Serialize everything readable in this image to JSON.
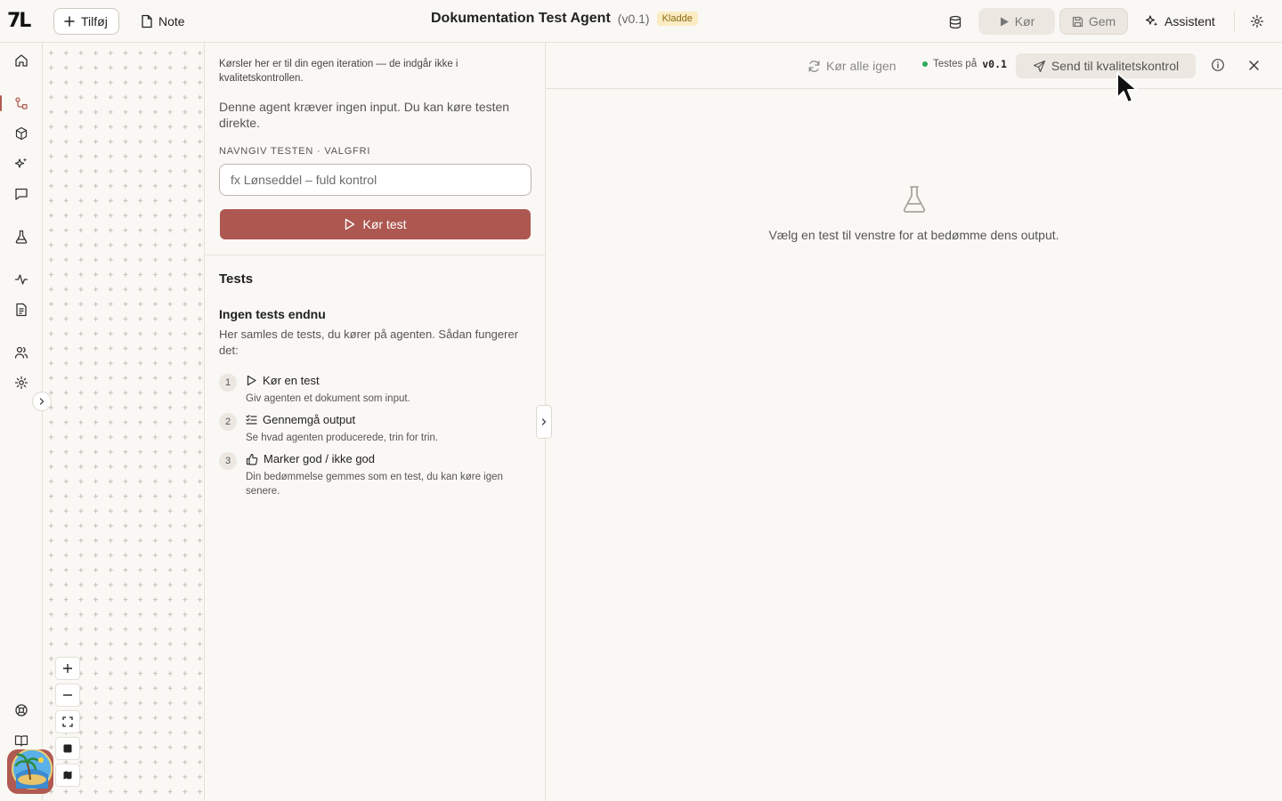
{
  "header": {
    "add_label": "Tilføj",
    "note_label": "Note",
    "title": "Dokumentation Test Agent",
    "version": "(v0.1)",
    "status_badge": "Kladde",
    "run_label": "Kør",
    "save_label": "Gem",
    "assistant_label": "Assistent"
  },
  "logo_text": "7L",
  "sidebar": {
    "items": [
      {
        "icon": "home-icon"
      },
      {
        "icon": "workflow-icon",
        "active": true
      },
      {
        "icon": "cube-icon"
      },
      {
        "icon": "sparkles-icon"
      },
      {
        "icon": "chat-icon"
      },
      {
        "icon": "flask-icon"
      },
      {
        "icon": "activity-icon"
      },
      {
        "icon": "document-icon"
      },
      {
        "icon": "users-icon"
      },
      {
        "icon": "settings-icon"
      },
      {
        "icon": "help-icon"
      },
      {
        "icon": "book-icon"
      }
    ]
  },
  "test_panel": {
    "info_text": "Kørsler her er til din egen iteration — de indgår ikke i kvalitetskontrollen.",
    "no_input_text": "Denne agent kræver ingen input. Du kan køre testen direkte.",
    "name_label": "Navngiv testen · Valgfri",
    "name_placeholder": "fx Lønseddel – fuld kontrol",
    "run_test_label": "Kør test",
    "tests_heading": "Tests",
    "empty_heading": "Ingen tests endnu",
    "empty_desc": "Her samles de tests, du kører på agenten. Sådan fungerer det:",
    "steps": [
      {
        "num": "1",
        "title": "Kør en test",
        "desc": "Giv agenten et dokument som input."
      },
      {
        "num": "2",
        "title": "Gennemgå output",
        "desc": "Se hvad agenten producerede, trin for trin."
      },
      {
        "num": "3",
        "title": "Marker god / ikke god",
        "desc": "Din bedømmelse gemmes som en test, du kan køre igen senere."
      }
    ]
  },
  "output_panel": {
    "rerun_label": "Kør alle igen",
    "testing_on_label": "Testes på",
    "testing_version": "v0.1",
    "send_label": "Send til kvalitetskontrol",
    "empty_message": "Vælg en test til venstre for at bedømme dens output."
  },
  "colors": {
    "accent": "#ad5751",
    "background": "#faf8f4",
    "badge_bg": "#fbecc4",
    "status_green": "#2faa5a"
  }
}
